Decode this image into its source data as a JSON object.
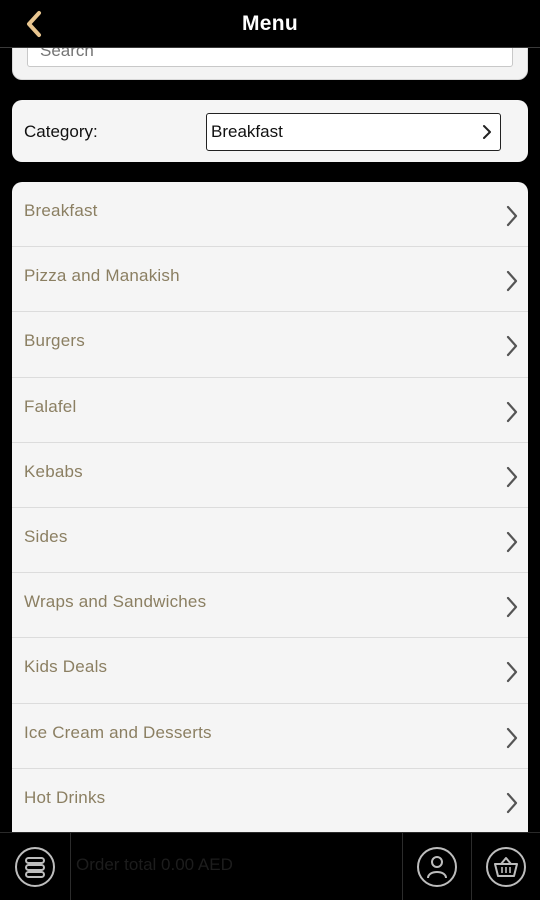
{
  "header": {
    "title": "Menu",
    "back_icon": "chevron-left-icon",
    "accent_color": "#e8c58f"
  },
  "search": {
    "placeholder": "Search"
  },
  "category": {
    "label": "Category:",
    "selected": "Breakfast"
  },
  "list": {
    "items": [
      {
        "label": "Breakfast"
      },
      {
        "label": "Pizza and Manakish"
      },
      {
        "label": "Burgers"
      },
      {
        "label": "Falafel"
      },
      {
        "label": "Kebabs"
      },
      {
        "label": "Sides"
      },
      {
        "label": "Wraps and Sandwiches"
      },
      {
        "label": "Kids Deals"
      },
      {
        "label": "Ice Cream and Desserts"
      },
      {
        "label": "Hot Drinks"
      }
    ],
    "text_color": "#8b7f62"
  },
  "bottom_bar": {
    "total_text": "Order total 0.00 AED",
    "menu_icon": "stack-icon",
    "account_icon": "user-icon",
    "basket_icon": "basket-icon"
  }
}
